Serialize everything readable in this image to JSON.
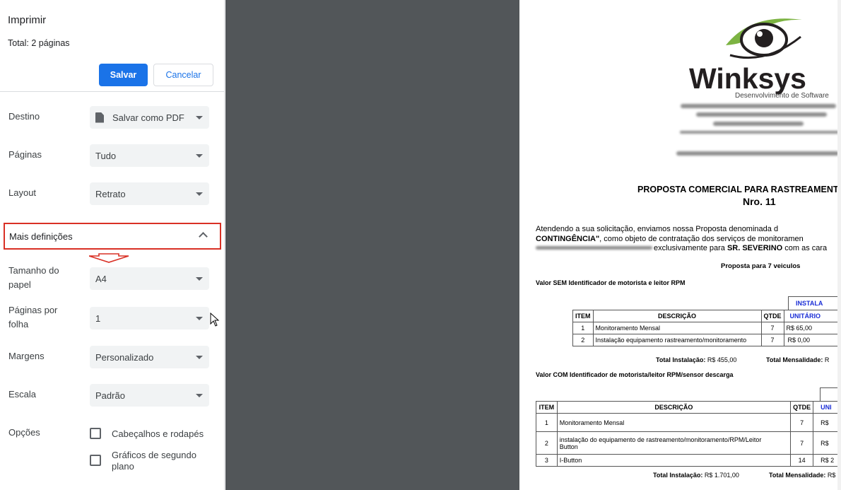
{
  "panel": {
    "title": "Imprimir",
    "total": "Total: 2 páginas",
    "save_label": "Salvar",
    "cancel_label": "Cancelar",
    "settings": [
      {
        "label": "Destino",
        "value": "Salvar como PDF"
      },
      {
        "label": "Páginas",
        "value": "Tudo"
      },
      {
        "label": "Layout",
        "value": "Retrato"
      }
    ],
    "more_settings": "Mais definições",
    "more": [
      {
        "label": "Tamanho do papel",
        "value": "A4"
      },
      {
        "label": "Páginas por folha",
        "value": "1"
      },
      {
        "label": "Margens",
        "value": "Personalizado"
      },
      {
        "label": "Escala",
        "value": "Padrão"
      }
    ],
    "options_label": "Opções",
    "options": [
      {
        "label": "Cabeçalhos e rodapés",
        "checked": false
      },
      {
        "label": "Gráficos de segundo plano",
        "checked": false
      }
    ]
  },
  "preview": {
    "logo": "Winksys",
    "logo_sub": "Desenvolvimento de Software",
    "title": "PROPOSTA COMERCIAL PARA RASTREAMENTO",
    "number": "Nro. 11",
    "para1": "Atendendo a sua solicitação, enviamos nossa Proposta denominada d",
    "para2_bold": "CONTINGÊNCIA\"",
    "para2_rest": ", como objeto de contratação dos serviços de monitoramen",
    "para3_rest": "exclusivamente para",
    "para3_client": "SR. SEVERINO",
    "para3_tail": "com as cara",
    "proposal_for": "Proposta para 7 veiculos",
    "section1": "Valor SEM Identificador de motorista e leitor RPM",
    "install_header": "INSTALA",
    "t1_headers": [
      "ITEM",
      "DESCRIÇÃO",
      "QTDE",
      "UNITÁRIO"
    ],
    "t1_rows": [
      {
        "item": "1",
        "desc": "Monitoramento Mensal",
        "qty": "7",
        "unit": "R$ 65,00"
      },
      {
        "item": "2",
        "desc": "Instalação equipamento rastreamento/monitoramento",
        "qty": "7",
        "unit": "R$ 0,00"
      }
    ],
    "t1_total_install_label": "Total Instalação:",
    "t1_total_install": "R$ 455,00",
    "t1_total_monthly_label": "Total Mensalidade:",
    "t1_total_monthly": "R",
    "section2": "Valor COM Identificador de motorista/leitor RPM/sensor descarga",
    "t2_headers": [
      "ITEM",
      "DESCRIÇÃO",
      "QTDE",
      "UNI"
    ],
    "t2_rows": [
      {
        "item": "1",
        "desc": "Monitoramento Mensal",
        "qty": "7",
        "unit": "R$"
      },
      {
        "item": "2",
        "desc": "instalação do equipamento de rastreamento/monitoramento/RPM/Leitor",
        "desc2": "Button",
        "qty": "7",
        "unit": "R$"
      },
      {
        "item": "3",
        "desc": "I-Button",
        "qty": "14",
        "unit": "R$ 2"
      }
    ],
    "t2_total_install_label": "Total Instalação:",
    "t2_total_install": "R$ 1.701,00",
    "t2_total_monthly_label": "Total Mensalidade:",
    "t2_total_monthly": "R$"
  },
  "colors": {
    "accent": "#1a73e8",
    "highlight_box": "#d93025",
    "preview_bg": "#525659",
    "logo_green": "#7cb342"
  }
}
